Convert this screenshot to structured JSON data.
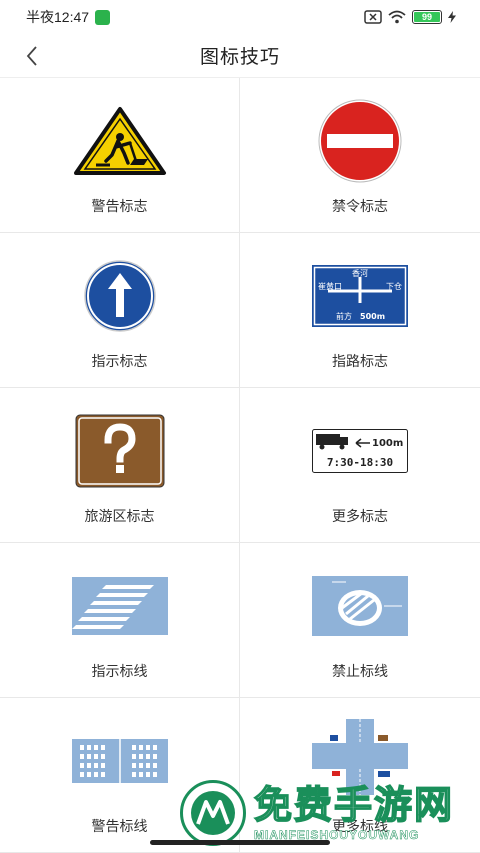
{
  "status_bar": {
    "time": "半夜12:47",
    "battery": "99"
  },
  "nav": {
    "title": "图标技巧",
    "back_icon": "chevron-left-icon"
  },
  "items": [
    {
      "label": "警告标志",
      "icon": "warning-sign-icon"
    },
    {
      "label": "禁令标志",
      "icon": "no-entry-sign-icon"
    },
    {
      "label": "指示标志",
      "icon": "direction-arrow-sign-icon"
    },
    {
      "label": "指路标志",
      "icon": "road-guide-sign-icon",
      "sign_text": [
        "香河",
        "崔黄口",
        "下仓",
        "前方",
        "500m"
      ]
    },
    {
      "label": "旅游区标志",
      "icon": "tourist-question-sign-icon"
    },
    {
      "label": "更多标志",
      "icon": "truck-time-sign-icon",
      "sign_text": [
        "100m",
        "7:30-18:30"
      ]
    },
    {
      "label": "指示标线",
      "icon": "crosswalk-marking-icon"
    },
    {
      "label": "禁止标线",
      "icon": "no-parking-marking-icon"
    },
    {
      "label": "警告标线",
      "icon": "warning-marking-icon"
    },
    {
      "label": "更多标线",
      "icon": "intersection-marking-icon"
    }
  ],
  "watermark": {
    "title": "免费手游网",
    "subtitle": "MIANFEISHOUYOUWANG"
  },
  "colors": {
    "warning_yellow": "#f5d000",
    "prohibit_red": "#d9231f",
    "guide_blue": "#1d4fa0",
    "tourist_brown": "#8a5a2b",
    "marking_blue": "#8fb2d8"
  }
}
